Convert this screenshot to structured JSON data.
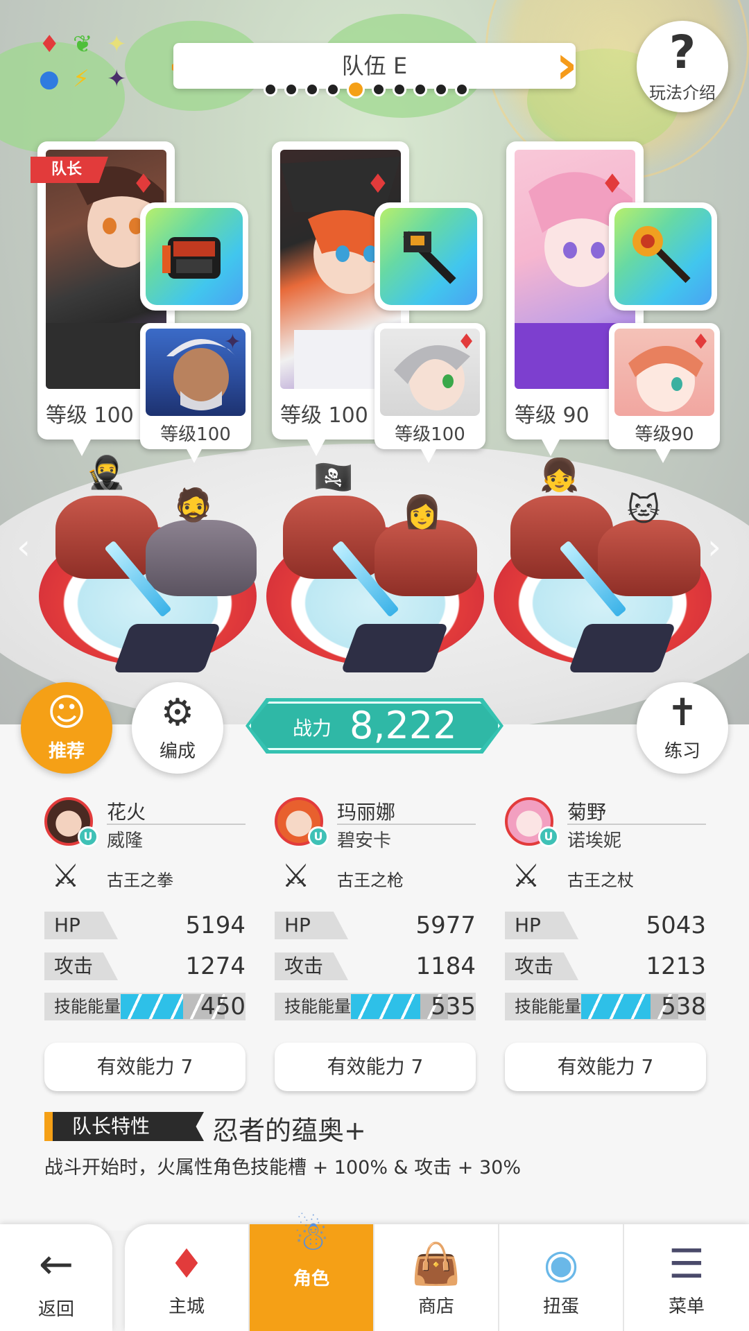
{
  "team": {
    "title": "队伍 E",
    "page_count": 10,
    "active_page": 5
  },
  "help": {
    "label": "玩法介绍"
  },
  "leader_tag": "队长",
  "characters": [
    {
      "main_level": "等级 100",
      "sub_level": "等级100",
      "weapon_icon": "gauntlet-icon",
      "gem": "fire"
    },
    {
      "main_level": "等级 100",
      "sub_level": "等级100",
      "weapon_icon": "spear-icon",
      "gem": "fire"
    },
    {
      "main_level": "等级 90",
      "sub_level": "等级90",
      "weapon_icon": "staff-icon",
      "gem": "fire"
    }
  ],
  "buttons": {
    "recommend": "推荐",
    "formation": "编成",
    "practice": "练习"
  },
  "power": {
    "label": "战力",
    "value": "8,222"
  },
  "columns": [
    {
      "name1": "花火",
      "name2": "威隆",
      "weapon": "古王之拳",
      "hp_label": "HP",
      "hp": "5194",
      "atk_label": "攻击",
      "atk": "1274",
      "skill_label": "技能能量",
      "skill": "450",
      "ability": "有效能力 7"
    },
    {
      "name1": "玛丽娜",
      "name2": "碧安卡",
      "weapon": "古王之枪",
      "hp_label": "HP",
      "hp": "5977",
      "atk_label": "攻击",
      "atk": "1184",
      "skill_label": "技能能量",
      "skill": "535",
      "ability": "有效能力 7"
    },
    {
      "name1": "菊野",
      "name2": "诺埃妮",
      "weapon": "古王之杖",
      "hp_label": "HP",
      "hp": "5043",
      "atk_label": "攻击",
      "atk": "1213",
      "skill_label": "技能能量",
      "skill": "538",
      "ability": "有效能力 7"
    }
  ],
  "leader_trait": {
    "label": "队长特性",
    "name": "忍者的蕴奥+",
    "description": "战斗开始时，火属性角色技能槽 + 100% & 攻击 + 30%"
  },
  "nav": {
    "back": "返回",
    "items": [
      "主城",
      "角色",
      "商店",
      "扭蛋",
      "菜单"
    ],
    "active": "角色"
  },
  "colors": {
    "accent": "#f5a016",
    "power": "#35c2b1",
    "fire": "#e23b3b",
    "skill_bar": "#2ec0e8"
  }
}
